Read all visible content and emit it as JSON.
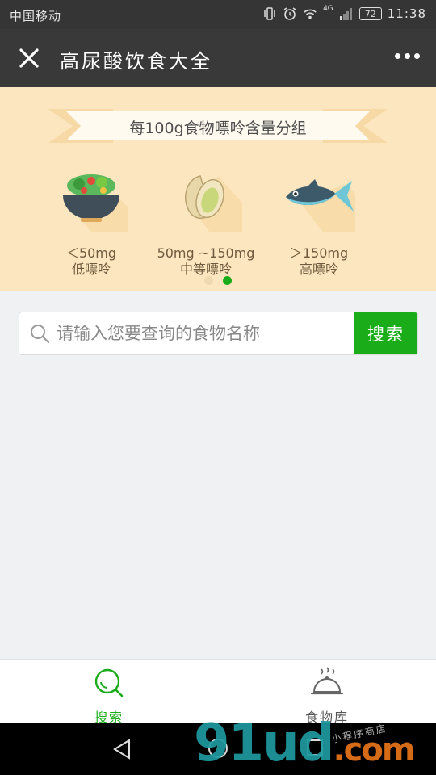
{
  "statusbar": {
    "carrier": "中国移动",
    "network": "4G",
    "battery": "72",
    "time": "11:38"
  },
  "navbar": {
    "title": "高尿酸饮食大全"
  },
  "banner": {
    "heading": "每100g食物嘌呤含量分组",
    "categories": [
      {
        "icon": "salad-bowl-icon",
        "range": "＜50mg",
        "level": "低嘌呤"
      },
      {
        "icon": "pistachio-icon",
        "range": "50mg ~150mg",
        "level": "中等嘌呤"
      },
      {
        "icon": "fish-icon",
        "range": "＞150mg",
        "level": "高嘌呤"
      }
    ],
    "active_slide": 2,
    "slide_count": 2
  },
  "search": {
    "placeholder": "请输入您要查询的食物名称",
    "button": "搜索"
  },
  "tabs": [
    {
      "icon": "search-icon",
      "label": "搜索",
      "active": true
    },
    {
      "icon": "food-cloche-icon",
      "label": "食物库",
      "active": false
    }
  ],
  "watermark": {
    "main": "91ud",
    "suffix": ".com",
    "side": "小程序商店"
  },
  "colors": {
    "accent": "#1aad19",
    "navbar": "#393939",
    "banner": "#fbe6bf"
  }
}
